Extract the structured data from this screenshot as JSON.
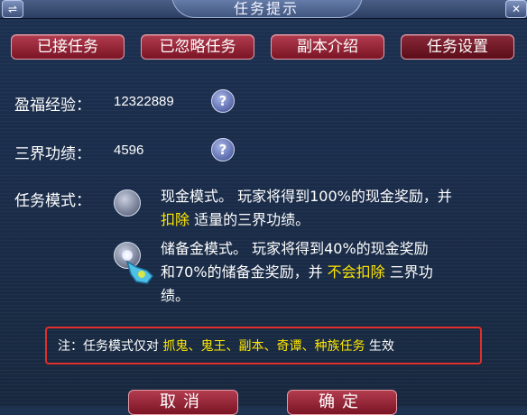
{
  "window": {
    "title": "任务提示",
    "left_button_glyph": "⇌",
    "close_glyph": "✕"
  },
  "tabs": [
    {
      "label": "已接任务",
      "active": false
    },
    {
      "label": "已忽略任务",
      "active": false
    },
    {
      "label": "副本介绍",
      "active": false
    },
    {
      "label": "任务设置",
      "active": true
    }
  ],
  "stats": {
    "exp_label": "盈福经验：",
    "exp_value": "12322889",
    "merit_label": "三界功绩：",
    "merit_value": "4596",
    "help_glyph": "?"
  },
  "mode": {
    "label": "任务模式：",
    "cash": {
      "line1": "现金模式。 玩家将得到100%的现金奖励，并",
      "line2_hl": "扣除",
      "line2_rest": " 适量的三界功绩。",
      "selected": false
    },
    "reserve": {
      "line1": "储备金模式。 玩家将得到40%的现金奖励",
      "line2_pre": "和70%的储备金奖励，并 ",
      "line2_hl": "不会扣除",
      "line2_post": " 三界功",
      "line3": "绩。",
      "selected": true
    }
  },
  "note": {
    "prefix": "注：任务模式仅对 ",
    "highlight": "抓鬼、鬼王、副本、奇谭、种族任务",
    "suffix": " 生效"
  },
  "buttons": {
    "cancel": "取消",
    "confirm": "确定"
  },
  "colors": {
    "highlight": "#ffe600",
    "tab_red": "#9a2236",
    "note_border": "#e0302c",
    "background": "#1c3050"
  }
}
